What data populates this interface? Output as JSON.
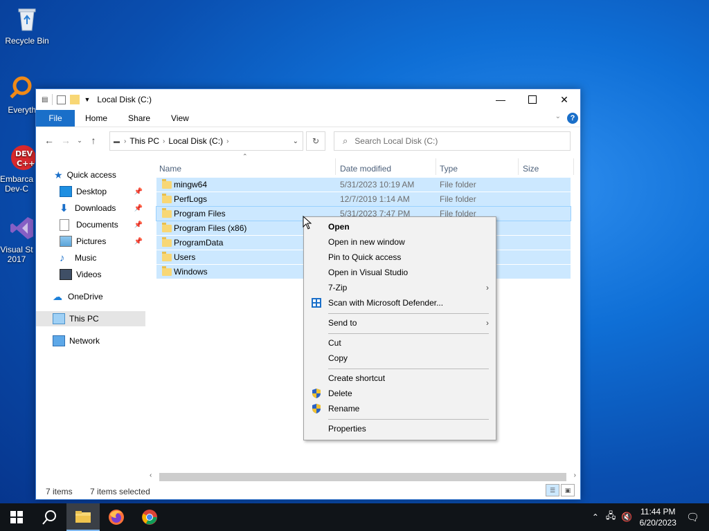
{
  "desktop": {
    "icons": [
      {
        "label": "Recycle Bin"
      },
      {
        "label": "Everyth"
      },
      {
        "label": "Embarca Dev-C"
      },
      {
        "label": "Visual St 2017"
      }
    ]
  },
  "window": {
    "title": "Local Disk (C:)",
    "ribbon_tabs": [
      "File",
      "Home",
      "Share",
      "View"
    ],
    "help_label": "?",
    "breadcrumb": [
      "This PC",
      "Local Disk (C:)"
    ],
    "search_placeholder": "Search Local Disk (C:)",
    "nav": {
      "quick_access": "Quick access",
      "items": [
        "Desktop",
        "Downloads",
        "Documents",
        "Pictures",
        "Music",
        "Videos"
      ],
      "onedrive": "OneDrive",
      "this_pc": "This PC",
      "network": "Network"
    },
    "columns": [
      "Name",
      "Date modified",
      "Type",
      "Size"
    ],
    "rows": [
      {
        "name": "mingw64",
        "date": "5/31/2023 10:19 AM",
        "type": "File folder"
      },
      {
        "name": "PerfLogs",
        "date": "12/7/2019 1:14 AM",
        "type": "File folder"
      },
      {
        "name": "Program Files",
        "date": "5/31/2023 7:47 PM",
        "type": "File folder"
      },
      {
        "name": "Program Files (x86)",
        "date": "",
        "type": ""
      },
      {
        "name": "ProgramData",
        "date": "",
        "type": ""
      },
      {
        "name": "Users",
        "date": "",
        "type": ""
      },
      {
        "name": "Windows",
        "date": "",
        "type": ""
      }
    ],
    "status": {
      "items": "7 items",
      "selected": "7 items selected"
    }
  },
  "context_menu": {
    "items": [
      {
        "label": "Open",
        "bold": true
      },
      {
        "label": "Open in new window"
      },
      {
        "label": "Pin to Quick access"
      },
      {
        "label": "Open in Visual Studio"
      },
      {
        "label": "7-Zip",
        "submenu": true
      },
      {
        "label": "Scan with Microsoft Defender...",
        "icon": "defender-icon"
      },
      {
        "label": "Send to",
        "submenu": true
      },
      {
        "label": "Cut"
      },
      {
        "label": "Copy"
      },
      {
        "label": "Create shortcut"
      },
      {
        "label": "Delete",
        "icon": "shield-icon"
      },
      {
        "label": "Rename",
        "icon": "shield-icon"
      },
      {
        "label": "Properties"
      }
    ]
  },
  "taskbar": {
    "time": "11:44 PM",
    "date": "6/20/2023"
  }
}
